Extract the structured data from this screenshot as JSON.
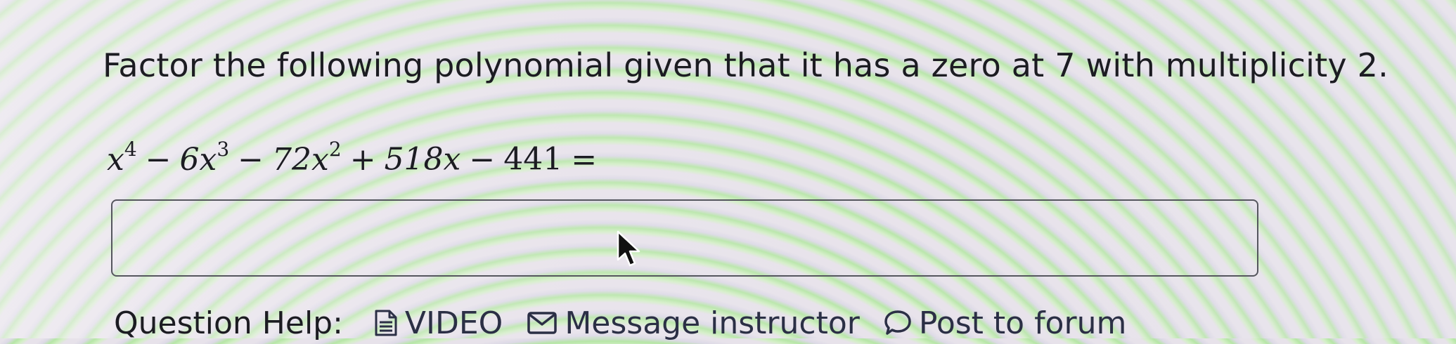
{
  "question": {
    "prompt": "Factor the following polynomial given that it has a zero at 7 with multiplicity 2."
  },
  "equation": {
    "term1_base": "x",
    "term1_exp": "4",
    "op1": "−",
    "term2_base": "6x",
    "term2_exp": "3",
    "op2": "−",
    "term3_base": "72x",
    "term3_exp": "2",
    "op3": "+",
    "term4": "518x",
    "op4": "−",
    "term5": "441",
    "equals": "="
  },
  "answer": {
    "value": ""
  },
  "help": {
    "label": "Question Help:",
    "video_label": "VIDEO",
    "message_label": "Message instructor",
    "forum_label": "Post to forum",
    "video_icon": "document-icon",
    "message_icon": "envelope-icon",
    "forum_icon": "speech-bubble-icon"
  }
}
